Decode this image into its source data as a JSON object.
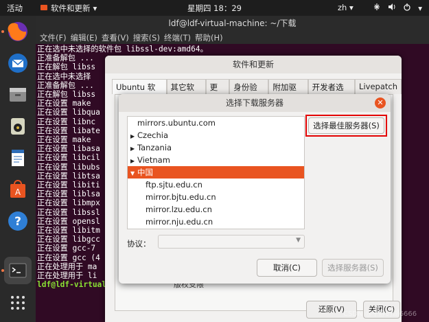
{
  "topbar": {
    "activities": "活动",
    "app_name": "软件和更新",
    "clock": "星期四 18：29",
    "input_lang": "zh"
  },
  "terminal": {
    "title": "ldf@ldf-virtual-machine: ~/下载",
    "menu": [
      "文件(F)",
      "编辑(E)",
      "查看(V)",
      "搜索(S)",
      "终端(T)",
      "帮助(H)"
    ],
    "lines": [
      "正在选中未选择的软件包 libssl-dev:amd64。",
      "正准备解包 ...",
      "正在解包 libss",
      "正在选中未选择",
      "正准备解包 ...",
      "正在解包 libss",
      "正在设置 make",
      "正在设置 libqua",
      "正在设置 libnc",
      "正在设置 libate",
      "正在设置 make",
      "正在设置 libasa",
      "正在设置 libcil",
      "正在设置 libubs",
      "正在设置 libtsa",
      "正在设置 libiti",
      "正在设置 liblsa",
      "正在设置 libmpx",
      "正在设置 libssl",
      "正在设置 opensl",
      "正在设置 libitm",
      "正在设置 libgcc",
      "正在设置 gcc-7",
      "正在设置 gcc (4",
      "正在处理用于 ma",
      "正在处理用于 li"
    ],
    "prompt_user": "ldf@ldf-virtual"
  },
  "software_window": {
    "title": "软件和更新",
    "tabs": [
      "Ubuntu 软件",
      "其它软件",
      "更新",
      "身份验证",
      "附加驱动",
      "开发者选项",
      "Livepatch"
    ],
    "license_text": "版权支限",
    "revert_button": "还原(V)",
    "close_button": "关闭(C)"
  },
  "dialog": {
    "title": "选择下载服务器",
    "list": [
      {
        "type": "top",
        "label": "mirrors.ubuntu.com"
      },
      {
        "type": "country",
        "label": "Czechia",
        "expanded": false
      },
      {
        "type": "country",
        "label": "Tanzania",
        "expanded": false
      },
      {
        "type": "country",
        "label": "Vietnam",
        "expanded": false
      },
      {
        "type": "country",
        "label": "中国",
        "expanded": true,
        "selected": true
      },
      {
        "type": "server",
        "label": "ftp.sjtu.edu.cn"
      },
      {
        "type": "server",
        "label": "mirror.bjtu.edu.cn"
      },
      {
        "type": "server",
        "label": "mirror.lzu.edu.cn"
      },
      {
        "type": "server",
        "label": "mirror.nju.edu.cn"
      }
    ],
    "best_server_button": "选择最佳服务器(S)",
    "protocol_label": "协议：",
    "protocol_value": "",
    "cancel_button": "取消(C)",
    "choose_button": "选择服务器(S)"
  },
  "watermark": "CSDN @平静的湖6666",
  "colors": {
    "accent": "#e95420",
    "terminal_bg": "#300a24",
    "highlight_box": "#e30000"
  }
}
